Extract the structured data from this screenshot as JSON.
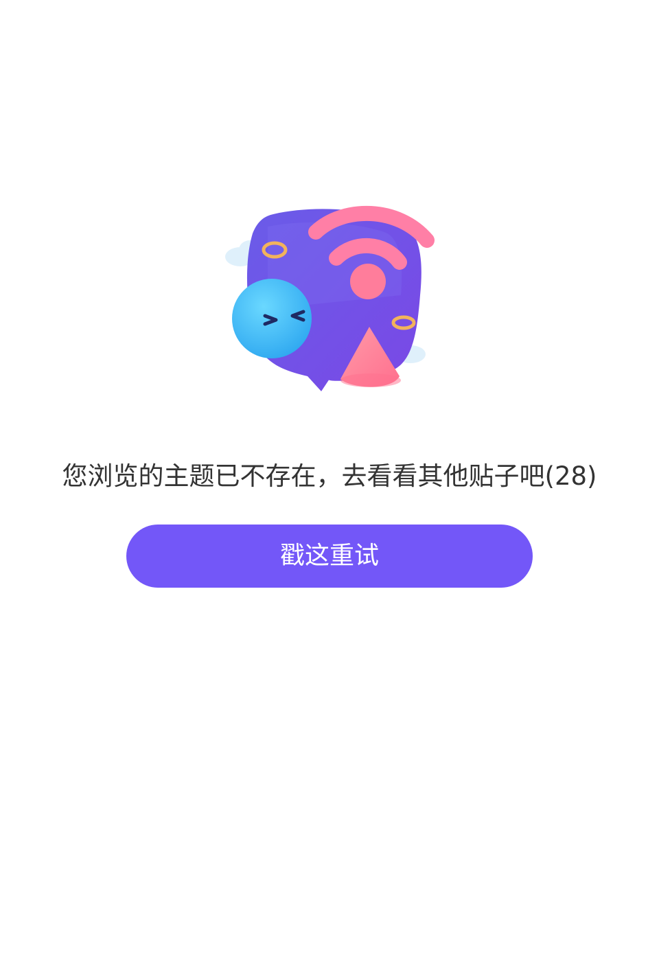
{
  "empty_state": {
    "illustration_icon": "offline-speech-bubble-illustration",
    "message": "您浏览的主题已不存在，去看看其他贴子吧(28)",
    "retry_label": "戳这重试"
  },
  "colors": {
    "accent": "#7357f8",
    "text": "#333333",
    "background": "#ffffff"
  }
}
